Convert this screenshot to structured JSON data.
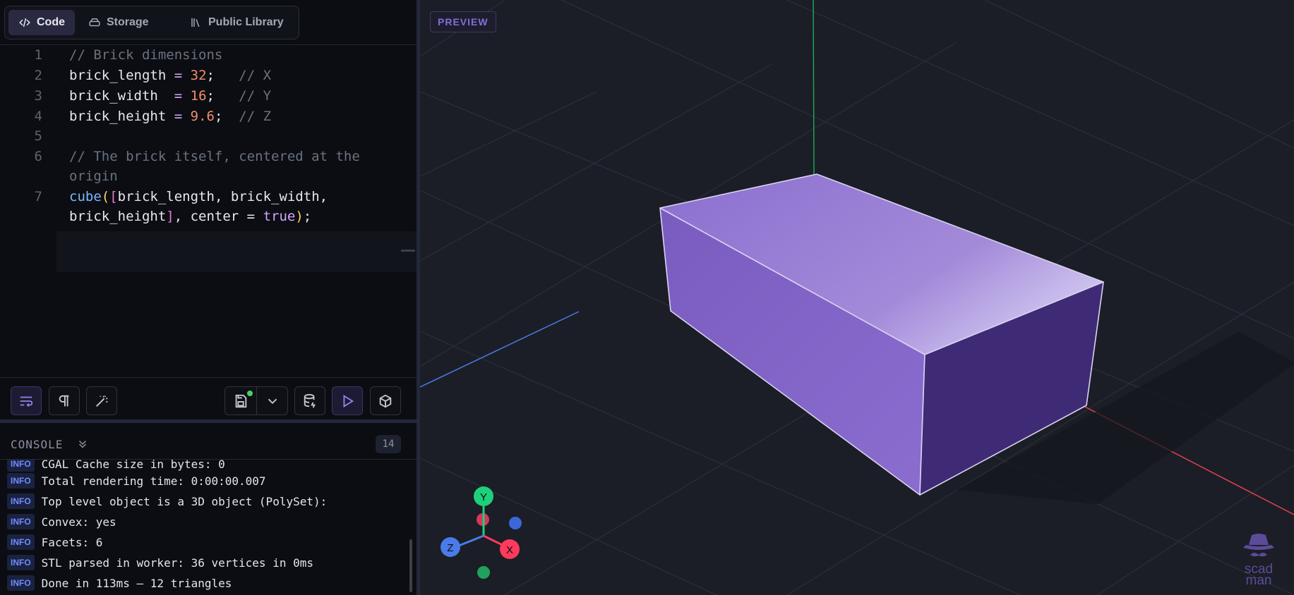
{
  "tabs": [
    {
      "label": "Code",
      "icon": "code-icon",
      "active": true
    },
    {
      "label": "Storage",
      "icon": "storage-icon",
      "active": false
    },
    {
      "label": "Public Library",
      "icon": "library-icon",
      "active": false
    }
  ],
  "editor": {
    "line_numbers": [
      "1",
      "2",
      "3",
      "4",
      "5",
      "6",
      "7"
    ],
    "lines": {
      "l1": "// Brick dimensions",
      "l2_var": "brick_length",
      "l2_val": "32",
      "l2_cmt": "// X",
      "l3_var": "brick_width",
      "l3_val": "16",
      "l3_cmt": "// Y",
      "l4_var": "brick_height",
      "l4_val": "9.6",
      "l4_cmt": "// Z",
      "l6a": "// The brick itself, centered at the",
      "l6b": "origin",
      "l7_fn": "cube",
      "l7_args1": "brick_length, brick_width,",
      "l7_args2": "brick_height",
      "l7_tail": ", center = ",
      "l7_kw": "true"
    }
  },
  "toolbar": {
    "buttons": [
      "wrap-lines-icon",
      "paragraph-icon",
      "magic-wand-icon",
      "save-icon",
      "chevron-down-icon",
      "database-icon",
      "play-icon",
      "cube-icon"
    ]
  },
  "console": {
    "title": "CONSOLE",
    "count": "14",
    "badge": "INFO",
    "entries": [
      "CGAL Cache size in bytes: 0",
      "Total rendering time: 0:00:00.007",
      "Top level object is a 3D object (PolySet):",
      "Convex: yes",
      "Facets: 6",
      "STL parsed in worker: 36 vertices in 0ms",
      "Done in 113ms — 12 triangles"
    ]
  },
  "preview": {
    "badge": "PREVIEW",
    "gizmo": {
      "y": "Y",
      "x": "X",
      "z": "Z"
    },
    "logo": {
      "line1": "scad",
      "line2": "man"
    },
    "colors": {
      "x_axis": "#e0424f",
      "y_axis": "#1fa35a",
      "z_axis": "#4a7be8",
      "brick": "#8b6fd0"
    }
  }
}
